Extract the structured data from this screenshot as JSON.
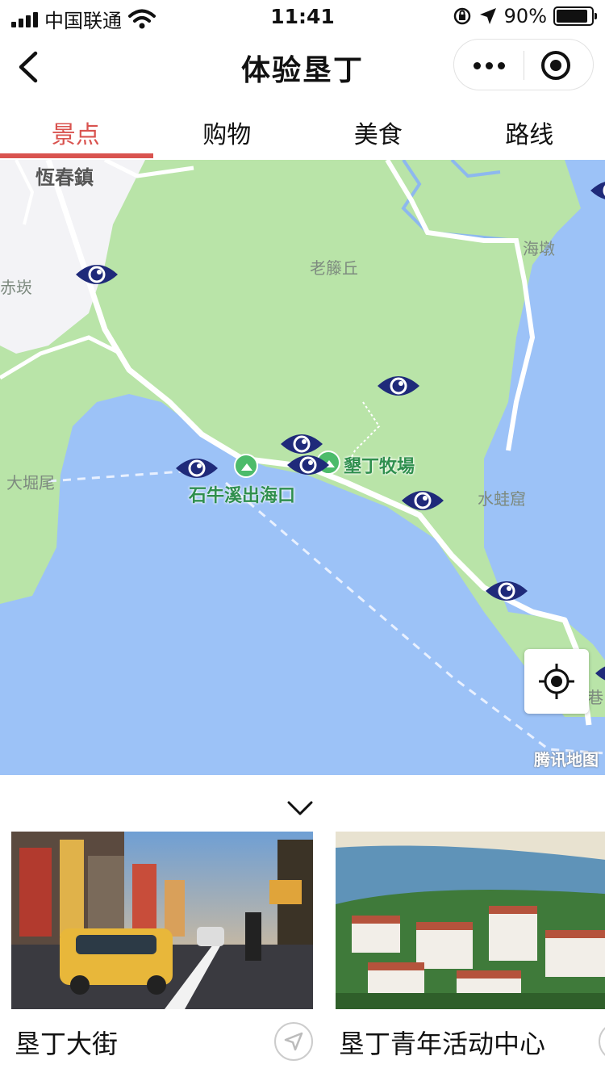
{
  "status_bar": {
    "carrier": "中国联通",
    "time": "11:41",
    "battery": "90%",
    "battery_level": 0.9
  },
  "nav": {
    "title": "体验垦丁",
    "back_icon": "chevron-left-icon",
    "more_icon": "more-dots-icon",
    "close_icon": "target-circle-icon"
  },
  "tabs": [
    {
      "label": "景点",
      "active": true
    },
    {
      "label": "购物",
      "active": false
    },
    {
      "label": "美食",
      "active": false
    },
    {
      "label": "路线",
      "active": false
    }
  ],
  "map": {
    "labels": {
      "town": "恆春鎮",
      "chikan": "赤崁",
      "laoteng": "老籐丘",
      "haidun": "海墩",
      "dajuewei": "大堀尾",
      "shuiwaku": "水蛙窟",
      "xiang": "巷"
    },
    "poi": {
      "shiniu": "石牛溪出海口",
      "kenting_ranch": "墾丁牧場"
    },
    "brand": "腾讯地图",
    "marker_icon": "eye-marker-icon",
    "locate_icon": "locate-crosshair-icon",
    "colors": {
      "water": "#9cc2f7",
      "land": "#b9e4a8",
      "urban": "#f3f3f6",
      "marker": "#1f2a7a",
      "accent": "#d9534f"
    }
  },
  "cards": [
    {
      "name": "垦丁大街",
      "nav_icon": "navigate-arrow-icon"
    },
    {
      "name": "垦丁青年活动中心",
      "nav_icon": "navigate-arrow-icon"
    }
  ]
}
